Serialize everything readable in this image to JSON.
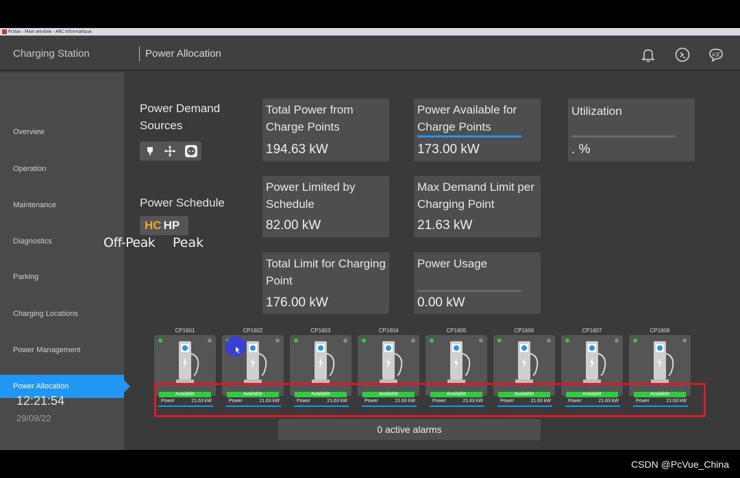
{
  "window": {
    "title": "PcVue - Main window - ARC Informatique"
  },
  "header": {
    "app_title": "Charging Station",
    "page_title": "Power Allocation"
  },
  "sidebar": {
    "items": [
      {
        "label": "Overview"
      },
      {
        "label": "Operation"
      },
      {
        "label": "Maintenance"
      },
      {
        "label": "Diagnostics"
      },
      {
        "label": "Parking"
      },
      {
        "label": "Charging Locations"
      },
      {
        "label": "Power Management"
      },
      {
        "label": "Power Allocation",
        "active": true
      }
    ],
    "time": "12:21:54",
    "date": "29/09/22"
  },
  "sources": {
    "label": "Power Demand Sources",
    "icons": [
      "lightbulb-icon",
      "fan-icon",
      "outlet-icon"
    ]
  },
  "schedule": {
    "label": "Power Schedule",
    "hc": "HC",
    "hp": "HP",
    "offpeak_label": "Off-Peak",
    "peak_label": "Peak"
  },
  "cards": {
    "total_power": {
      "title": "Total Power from Charge Points",
      "value": "194.63 kW"
    },
    "available": {
      "title": "Power Available for Charge Points",
      "value": "173.00 kW",
      "level": 1.0
    },
    "utilization": {
      "title": "Utilization",
      "value": ". %",
      "level": 0
    },
    "limited_schedule": {
      "title": "Power Limited by Schedule",
      "value": "82.00 kW"
    },
    "max_demand": {
      "title": "Max Demand Limit per Charging Point",
      "value": "21.63 kW"
    },
    "total_limit": {
      "title": "Total Limit for Charging Point",
      "value": "176.00 kW"
    },
    "usage": {
      "title": "Power Usage",
      "value": "0.00 kW",
      "level": 0
    }
  },
  "charge_points": [
    {
      "name": "CP1601",
      "status": "Available",
      "power_label": "Power",
      "power": "21.63 kW"
    },
    {
      "name": "CP1602",
      "status": "Available",
      "power_label": "Power",
      "power": "21.63 kW"
    },
    {
      "name": "CP1603",
      "status": "Available",
      "power_label": "Power",
      "power": "21.63 kW"
    },
    {
      "name": "CP1604",
      "status": "Available",
      "power_label": "Power",
      "power": "21.63 kW"
    },
    {
      "name": "CP1605",
      "status": "Available",
      "power_label": "Power",
      "power": "21.63 kW"
    },
    {
      "name": "CP1606",
      "status": "Available",
      "power_label": "Power",
      "power": "21.63 kW"
    },
    {
      "name": "CP1607",
      "status": "Available",
      "power_label": "Power",
      "power": "21.63 kW"
    },
    {
      "name": "CP1608",
      "status": "Available",
      "power_label": "Power",
      "power": "21.63 kW"
    }
  ],
  "alarms": {
    "text": "0 active alarms"
  },
  "watermark": "CSDN @PcVue_China",
  "colors": {
    "accent": "#2196f3",
    "available": "#2ecc40",
    "highlight": "#e0182d",
    "hc": "#f5a623"
  }
}
